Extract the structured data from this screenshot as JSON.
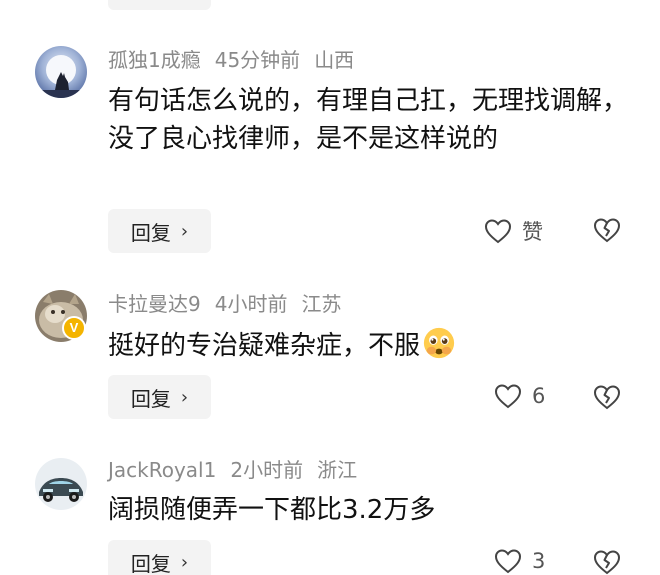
{
  "comments": [
    {
      "username": "孤独1成瘾",
      "time": "45分钟前",
      "location": "山西",
      "text": "有句话怎么说的，有理自己扛，无理找调解，没了良心找律师，是不是这样说的",
      "reply_label": "回复",
      "like_label": "赞",
      "avatar_icon": "wolf-moon-avatar",
      "verified": false
    },
    {
      "username": "卡拉曼达9",
      "time": "4小时前",
      "location": "江苏",
      "text": "挺好的专治疑难杂症，不服",
      "emoji": "pleading-face-emoji",
      "reply_label": "回复",
      "like_label": "6",
      "avatar_icon": "cat-avatar",
      "verified": true,
      "badge_text": "V"
    },
    {
      "username": "JackRoyal1",
      "time": "2小时前",
      "location": "浙江",
      "text": "阔损随便弄一下都比3.2万多",
      "reply_label": "回复",
      "like_label": "3",
      "avatar_icon": "sports-car-avatar",
      "verified": false
    }
  ],
  "colors": {
    "meta_text": "#8a8a8a",
    "reply_bg": "#f3f3f3",
    "badge": "#f4b400"
  },
  "icons": {
    "reply_chevron": "chevron-right-icon",
    "like": "heart-outline-icon",
    "dislike": "broken-heart-icon"
  }
}
